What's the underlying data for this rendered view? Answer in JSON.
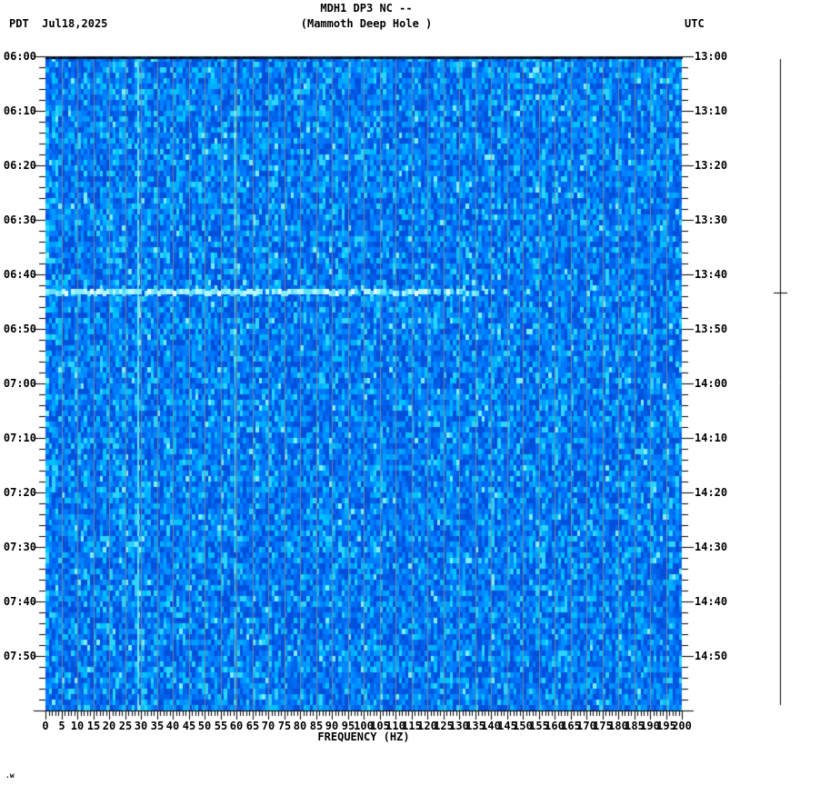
{
  "header": {
    "left_timezone": "PDT",
    "date": "Jul18,2025",
    "title": "MDH1 DP3 NC --",
    "subtitle": "(Mammoth Deep Hole )",
    "right_timezone": "UTC"
  },
  "footnote": ".w",
  "chart_data": {
    "type": "heatmap",
    "subtype": "seismic-spectrogram",
    "title": "MDH1 DP3 NC --",
    "station_name": "(Mammoth Deep Hole )",
    "xlabel": "FREQUENCY (HZ)",
    "x_range": [
      0,
      200
    ],
    "x_major_tick_step_hz": 5,
    "x_minor_tick_step_hz": 1,
    "x_tick_labels": [
      "0",
      "5",
      "10",
      "15",
      "20",
      "25",
      "30",
      "35",
      "40",
      "45",
      "50",
      "55",
      "60",
      "65",
      "70",
      "75",
      "80",
      "85",
      "90",
      "95",
      "100",
      "105",
      "110",
      "115",
      "120",
      "125",
      "130",
      "135",
      "140",
      "145",
      "150",
      "155",
      "160",
      "165",
      "170",
      "175",
      "180",
      "185",
      "190",
      "195",
      "200"
    ],
    "y_left_axis": {
      "timezone": "PDT",
      "start": "06:00",
      "end": "08:00",
      "tick_labels": [
        "06:00",
        "06:10",
        "06:20",
        "06:30",
        "06:40",
        "06:50",
        "07:00",
        "07:10",
        "07:20",
        "07:30",
        "07:40",
        "07:50"
      ]
    },
    "y_right_axis": {
      "timezone": "UTC",
      "start": "13:00",
      "end": "15:00",
      "tick_labels": [
        "13:00",
        "13:10",
        "13:20",
        "13:30",
        "13:40",
        "13:50",
        "14:00",
        "14:10",
        "14:20",
        "14:30",
        "14:40",
        "14:50"
      ]
    },
    "y_major_tick_minutes": 10,
    "y_minor_tick_minutes": 2,
    "grid": {
      "vertical_gridline_every_hz": 5,
      "gridline_color": "#8c8c8c"
    },
    "palette": {
      "base_blues": [
        "#0050dc",
        "#0060e8",
        "#006cf2",
        "#0078fa",
        "#0082ff",
        "#008eff",
        "#009cff",
        "#00aeff",
        "#00c2ff",
        "#2cd4ff"
      ],
      "speckle_bright": "#7deeff",
      "top_row_dark": [
        "#000d1f",
        "#001a33",
        "#002747"
      ]
    },
    "features": [
      {
        "name": "broadband-event-line",
        "time_pdt": "06:43",
        "time_utc": "13:43",
        "freq_span_hz": [
          0,
          157
        ],
        "colors": [
          "#e2ffff",
          "#b4f7ff",
          "#8aedff",
          "#5fe0ff"
        ]
      },
      {
        "name": "narrowband-tone-band",
        "freq_hz": 29,
        "colors": [
          "#49d3ff",
          "#7ae3ff"
        ]
      },
      {
        "name": "powerline-tone-line",
        "freq_hz": 60,
        "colors": [
          "#6fe0a8",
          "#8ceec4",
          "#57d8ff"
        ]
      }
    ],
    "amplitude_trace": {
      "event_time_pdt": "06:43",
      "line_color": "#000000"
    }
  }
}
